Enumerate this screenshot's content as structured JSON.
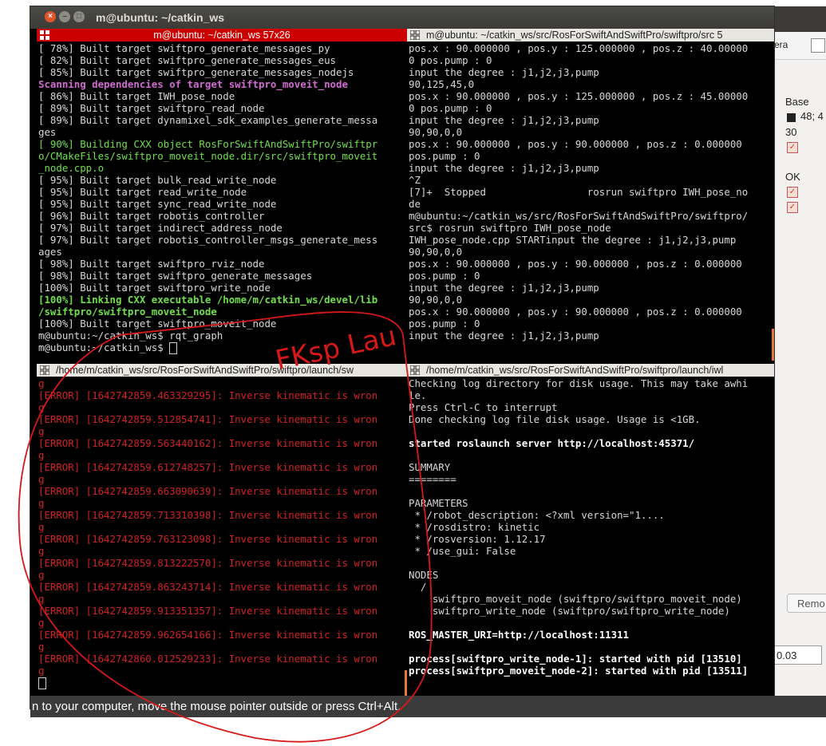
{
  "window": {
    "title": "m@ubuntu: ~/catkin_ws"
  },
  "panes": {
    "top_left": {
      "title": "m@ubuntu: ~/catkin_ws 57x26",
      "lines": [
        {
          "t": "[ 78%] Built target swiftpro_generate_messages_py",
          "c": ""
        },
        {
          "t": "[ 82%] Built target swiftpro_generate_messages_eus",
          "c": ""
        },
        {
          "t": "[ 85%] Built target swiftpro_generate_messages_nodejs",
          "c": ""
        },
        {
          "t": "Scanning dependencies of target swiftpro_moveit_node",
          "c": "magenta"
        },
        {
          "t": "[ 86%] Built target IWH_pose_node",
          "c": ""
        },
        {
          "t": "[ 89%] Built target swiftpro_read_node",
          "c": ""
        },
        {
          "t": "[ 89%] Built target dynamixel_sdk_examples_generate_messa",
          "c": ""
        },
        {
          "t": "ges",
          "c": ""
        },
        {
          "t": "[ 90%] Building CXX object RosForSwiftAndSwiftPro/swiftpr",
          "c": "greenplain"
        },
        {
          "t": "o/CMakeFiles/swiftpro_moveit_node.dir/src/swiftpro_moveit",
          "c": "greenplain"
        },
        {
          "t": "_node.cpp.o",
          "c": "greenplain"
        },
        {
          "t": "[ 95%] Built target bulk_read_write_node",
          "c": ""
        },
        {
          "t": "[ 95%] Built target read_write_node",
          "c": ""
        },
        {
          "t": "[ 95%] Built target sync_read_write_node",
          "c": ""
        },
        {
          "t": "[ 96%] Built target robotis_controller",
          "c": ""
        },
        {
          "t": "[ 97%] Built target indirect_address_node",
          "c": ""
        },
        {
          "t": "[ 97%] Built target robotis_controller_msgs_generate_mess",
          "c": ""
        },
        {
          "t": "ages",
          "c": ""
        },
        {
          "t": "[ 98%] Built target swiftpro_rviz_node",
          "c": ""
        },
        {
          "t": "[ 98%] Built target swiftpro_generate_messages",
          "c": ""
        },
        {
          "t": "[100%] Built target swiftpro_write_node",
          "c": ""
        },
        {
          "t": "[100%] Linking CXX executable /home/m/catkin_ws/devel/lib",
          "c": "green"
        },
        {
          "t": "/swiftpro/swiftpro_moveit_node",
          "c": "green"
        },
        {
          "t": "[100%] Built target swiftpro_moveit_node",
          "c": ""
        },
        {
          "t": "m@ubuntu:~/catkin_ws$ rqt_graph",
          "c": ""
        },
        {
          "t": "m@ubuntu:~/catkin_ws$ ",
          "c": "cursorline"
        }
      ]
    },
    "top_right": {
      "title": "m@ubuntu: ~/catkin_ws/src/RosForSwiftAndSwiftPro/swiftpro/src 5",
      "lines": [
        {
          "t": "pos.x : 90.000000 , pos.y : 125.000000 , pos.z : 40.00000",
          "c": ""
        },
        {
          "t": "0 pos.pump : 0",
          "c": ""
        },
        {
          "t": "input the degree : j1,j2,j3,pump",
          "c": ""
        },
        {
          "t": "90,125,45,0",
          "c": ""
        },
        {
          "t": "pos.x : 90.000000 , pos.y : 125.000000 , pos.z : 45.00000",
          "c": ""
        },
        {
          "t": "0 pos.pump : 0",
          "c": ""
        },
        {
          "t": "input the degree : j1,j2,j3,pump",
          "c": ""
        },
        {
          "t": "90,90,0,0",
          "c": ""
        },
        {
          "t": "pos.x : 90.000000 , pos.y : 90.000000 , pos.z : 0.000000",
          "c": ""
        },
        {
          "t": "pos.pump : 0",
          "c": ""
        },
        {
          "t": "input the degree : j1,j2,j3,pump",
          "c": ""
        },
        {
          "t": "^Z",
          "c": ""
        },
        {
          "t": "[7]+  Stopped                 rosrun swiftpro IWH_pose_no",
          "c": ""
        },
        {
          "t": "de",
          "c": ""
        },
        {
          "t": "m@ubuntu:~/catkin_ws/src/RosForSwiftAndSwiftPro/swiftpro/",
          "c": ""
        },
        {
          "t": "src$ rosrun swiftpro IWH_pose_node",
          "c": ""
        },
        {
          "t": "IWH_pose_node.cpp STARTinput the degree : j1,j2,j3,pump",
          "c": ""
        },
        {
          "t": "90,90,0,0",
          "c": ""
        },
        {
          "t": "pos.x : 90.000000 , pos.y : 90.000000 , pos.z : 0.000000",
          "c": ""
        },
        {
          "t": "pos.pump : 0",
          "c": ""
        },
        {
          "t": "input the degree : j1,j2,j3,pump",
          "c": ""
        },
        {
          "t": "90,90,0,0",
          "c": ""
        },
        {
          "t": "pos.x : 90.000000 , pos.y : 90.000000 , pos.z : 0.000000",
          "c": ""
        },
        {
          "t": "pos.pump : 0",
          "c": ""
        },
        {
          "t": "input the degree : j1,j2,j3,pump",
          "c": ""
        }
      ]
    },
    "bottom_left": {
      "title": "/home/m/catkin_ws/src/RosForSwiftAndSwiftPro/swiftpro/launch/sw",
      "lines": [
        {
          "t": "g",
          "c": "red"
        },
        {
          "t": "[ERROR] [1642742859.463329295]: Inverse kinematic is wron",
          "c": "red"
        },
        {
          "t": "g",
          "c": "red"
        },
        {
          "t": "[ERROR] [1642742859.512854741]: Inverse kinematic is wron",
          "c": "red"
        },
        {
          "t": "g",
          "c": "red"
        },
        {
          "t": "[ERROR] [1642742859.563440162]: Inverse kinematic is wron",
          "c": "red"
        },
        {
          "t": "g",
          "c": "red"
        },
        {
          "t": "[ERROR] [1642742859.612748257]: Inverse kinematic is wron",
          "c": "red"
        },
        {
          "t": "g",
          "c": "red"
        },
        {
          "t": "[ERROR] [1642742859.663090639]: Inverse kinematic is wron",
          "c": "red"
        },
        {
          "t": "g",
          "c": "red"
        },
        {
          "t": "[ERROR] [1642742859.713310398]: Inverse kinematic is wron",
          "c": "red"
        },
        {
          "t": "g",
          "c": "red"
        },
        {
          "t": "[ERROR] [1642742859.763123098]: Inverse kinematic is wron",
          "c": "red"
        },
        {
          "t": "g",
          "c": "red"
        },
        {
          "t": "[ERROR] [1642742859.813222570]: Inverse kinematic is wron",
          "c": "red"
        },
        {
          "t": "g",
          "c": "red"
        },
        {
          "t": "[ERROR] [1642742859.863243714]: Inverse kinematic is wron",
          "c": "red"
        },
        {
          "t": "g",
          "c": "red"
        },
        {
          "t": "[ERROR] [1642742859.913351357]: Inverse kinematic is wron",
          "c": "red"
        },
        {
          "t": "g",
          "c": "red"
        },
        {
          "t": "[ERROR] [1642742859.962654166]: Inverse kinematic is wron",
          "c": "red"
        },
        {
          "t": "g",
          "c": "red"
        },
        {
          "t": "[ERROR] [1642742860.012529233]: Inverse kinematic is wron",
          "c": "red"
        },
        {
          "t": "g",
          "c": "red"
        },
        {
          "t": "",
          "c": "cursorline"
        }
      ]
    },
    "bottom_right": {
      "title": "/home/m/catkin_ws/src/RosForSwiftAndSwiftPro/swiftpro/launch/iwl",
      "lines": [
        {
          "t": "Checking log directory for disk usage. This may take awhi",
          "c": ""
        },
        {
          "t": "le.",
          "c": ""
        },
        {
          "t": "Press Ctrl-C to interrupt",
          "c": ""
        },
        {
          "t": "Done checking log file disk usage. Usage is <1GB.",
          "c": ""
        },
        {
          "t": "",
          "c": ""
        },
        {
          "t": "started roslaunch server http://localhost:45371/",
          "c": "bold"
        },
        {
          "t": "",
          "c": ""
        },
        {
          "t": "SUMMARY",
          "c": ""
        },
        {
          "t": "========",
          "c": ""
        },
        {
          "t": "",
          "c": ""
        },
        {
          "t": "PARAMETERS",
          "c": ""
        },
        {
          "t": " * /robot_description: <?xml version=\"1....",
          "c": ""
        },
        {
          "t": " * /rosdistro: kinetic",
          "c": ""
        },
        {
          "t": " * /rosversion: 1.12.17",
          "c": ""
        },
        {
          "t": " * /use_gui: False",
          "c": ""
        },
        {
          "t": "",
          "c": ""
        },
        {
          "t": "NODES",
          "c": ""
        },
        {
          "t": "  /",
          "c": ""
        },
        {
          "t": "    swiftpro_moveit_node (swiftpro/swiftpro_moveit_node)",
          "c": ""
        },
        {
          "t": "    swiftpro_write_node (swiftpro/swiftpro_write_node)",
          "c": ""
        },
        {
          "t": "",
          "c": ""
        },
        {
          "t": "ROS_MASTER_URI=http://localhost:11311",
          "c": "bold"
        },
        {
          "t": "",
          "c": ""
        },
        {
          "t": "process[swiftpro_write_node-1]: started with pid [13510]",
          "c": "bold"
        },
        {
          "t": "process[swiftpro_moveit_node-2]: started with pid [13511]",
          "c": "bold"
        }
      ]
    }
  },
  "side_panel": {
    "top_label": "era",
    "base_label": "Base",
    "color_value": "48; 4",
    "number_value": "30",
    "ok_label": "OK",
    "remove_button": "Remo",
    "value_field": "0.03"
  },
  "status_bar": {
    "text": "n to your computer, move the mouse pointer outside or press Ctrl+Alt."
  },
  "handwriting": {
    "text": "FKsp Lau"
  },
  "colors": {
    "active_title": "#cc0000",
    "error_red": "#d02222",
    "build_green": "#6fe04a",
    "scan_magenta": "#d36ad3"
  }
}
